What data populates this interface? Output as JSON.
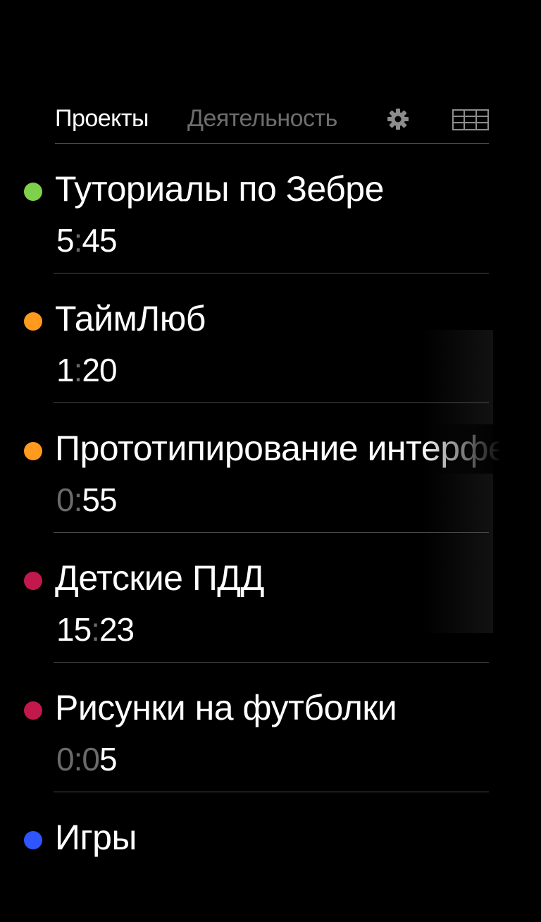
{
  "header": {
    "tab_projects": "Проекты",
    "tab_activity": "Деятельность",
    "settings_icon": "gear-icon",
    "grid_icon": "grid-icon"
  },
  "projects": [
    {
      "name": "Туториалы по Зебре",
      "time_h": "5",
      "time_sep": ":",
      "time_m": "45",
      "dim_h": false,
      "dim_m0": false,
      "color": "#7ed14a"
    },
    {
      "name": "ТаймЛюб",
      "time_h": "1",
      "time_sep": ":",
      "time_m": "20",
      "dim_h": false,
      "dim_m0": false,
      "color": "#ff9a1f"
    },
    {
      "name": "Прототипирование интерфе",
      "time_h": "0",
      "time_sep": ":",
      "time_m": "55",
      "dim_h": true,
      "dim_m0": false,
      "color": "#ff9a1f"
    },
    {
      "name": "Детские ПДД",
      "time_h": "15",
      "time_sep": ":",
      "time_m": "23",
      "dim_h": false,
      "dim_m0": false,
      "color": "#c2184b"
    },
    {
      "name": "Рисунки на футболки",
      "time_h": "0",
      "time_sep": ":",
      "time_m0": "0",
      "time_m1": "5",
      "dim_h": true,
      "dim_m0": true,
      "color": "#c2184b"
    },
    {
      "name": "Игры",
      "color": "#2f55ff"
    }
  ]
}
